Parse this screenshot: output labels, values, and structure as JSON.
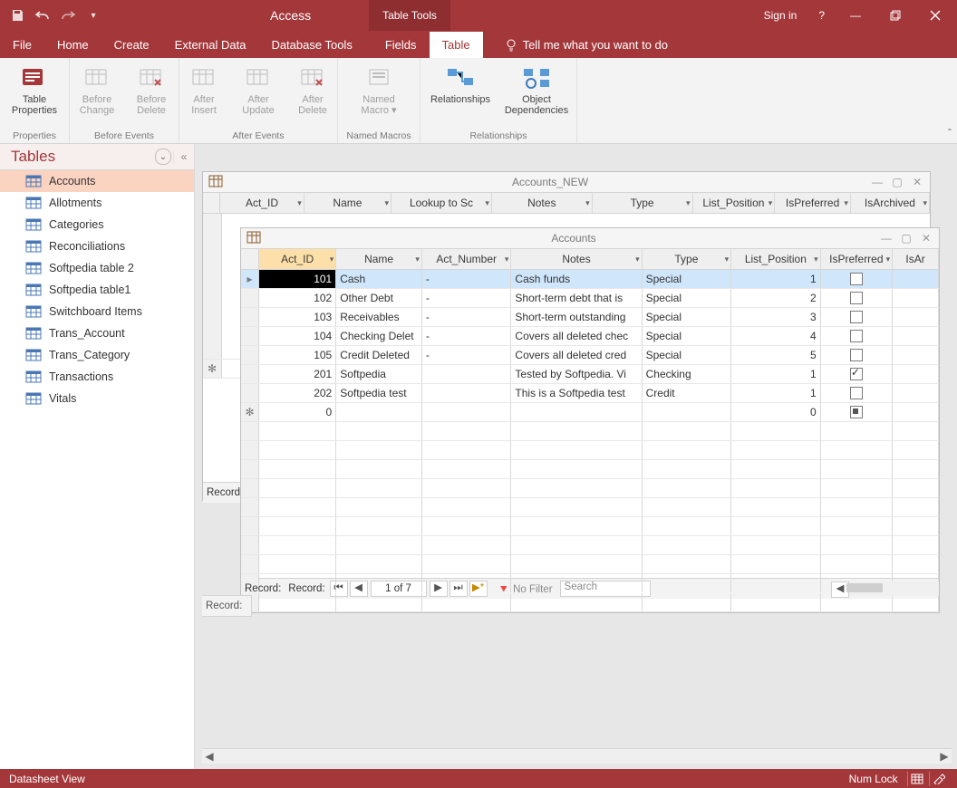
{
  "titlebar": {
    "app": "Access",
    "tool_context": "Table Tools",
    "signin": "Sign in"
  },
  "menutabs": {
    "file": "File",
    "home": "Home",
    "create": "Create",
    "external": "External Data",
    "dbtools": "Database Tools",
    "fields": "Fields",
    "table": "Table",
    "tellme": "Tell me what you want to do"
  },
  "ribbon": {
    "groups": {
      "properties": {
        "label": "Properties",
        "table_properties": "Table\nProperties"
      },
      "before": {
        "label": "Before Events",
        "before_change": "Before\nChange",
        "before_delete": "Before\nDelete"
      },
      "after": {
        "label": "After Events",
        "after_insert": "After\nInsert",
        "after_update": "After\nUpdate",
        "after_delete": "After\nDelete"
      },
      "macros": {
        "label": "Named Macros",
        "named_macro": "Named\nMacro ▾"
      },
      "relationships": {
        "label": "Relationships",
        "relationships": "Relationships",
        "object_deps": "Object\nDependencies"
      }
    }
  },
  "nav": {
    "title": "Tables",
    "items": [
      {
        "label": "Accounts",
        "selected": true
      },
      {
        "label": "Allotments"
      },
      {
        "label": "Categories"
      },
      {
        "label": "Reconciliations"
      },
      {
        "label": "Softpedia table 2"
      },
      {
        "label": "Softpedia table1"
      },
      {
        "label": "Switchboard Items"
      },
      {
        "label": "Trans_Account"
      },
      {
        "label": "Trans_Category"
      },
      {
        "label": "Transactions"
      },
      {
        "label": "Vitals"
      }
    ]
  },
  "back_window": {
    "title": "Accounts_NEW",
    "columns": [
      "Act_ID",
      "Name",
      "Lookup to Sc",
      "Notes",
      "Type",
      "List_Position",
      "IsPreferred",
      "IsArchived"
    ],
    "records_label": "Records"
  },
  "front_window": {
    "title": "Accounts",
    "columns": [
      "Act_ID",
      "Name",
      "Act_Number",
      "Notes",
      "Type",
      "List_Position",
      "IsPreferred",
      "IsAr"
    ],
    "rows": [
      {
        "Act_ID": "101",
        "Name": "Cash",
        "Act_Number": "-",
        "Notes": "Cash funds",
        "Type": "Special",
        "List_Position": "1",
        "IsPreferred": false,
        "selected": true
      },
      {
        "Act_ID": "102",
        "Name": "Other Debt",
        "Act_Number": "-",
        "Notes": "Short-term debt that is",
        "Type": "Special",
        "List_Position": "2",
        "IsPreferred": false
      },
      {
        "Act_ID": "103",
        "Name": "Receivables",
        "Act_Number": "-",
        "Notes": "Short-term outstanding",
        "Type": "Special",
        "List_Position": "3",
        "IsPreferred": false
      },
      {
        "Act_ID": "104",
        "Name": "Checking Delet",
        "Act_Number": "-",
        "Notes": "Covers all deleted chec",
        "Type": "Special",
        "List_Position": "4",
        "IsPreferred": false
      },
      {
        "Act_ID": "105",
        "Name": "Credit Deleted",
        "Act_Number": "-",
        "Notes": "Covers all deleted cred",
        "Type": "Special",
        "List_Position": "5",
        "IsPreferred": false
      },
      {
        "Act_ID": "201",
        "Name": "Softpedia",
        "Act_Number": "",
        "Notes": "Tested by Softpedia. Vi",
        "Type": "Checking",
        "List_Position": "1",
        "IsPreferred": true
      },
      {
        "Act_ID": "202",
        "Name": "Softpedia test",
        "Act_Number": "",
        "Notes": "This is a Softpedia test",
        "Type": "Credit",
        "List_Position": "1",
        "IsPreferred": false
      }
    ],
    "newrow": {
      "Act_ID": "0",
      "List_Position": "0"
    },
    "record_label1": "Record:",
    "record_label2": "Record:",
    "record_pos": "1 of 7",
    "filter_label": "No Filter",
    "search_placeholder": "Search"
  },
  "statusbar": {
    "view": "Datasheet View",
    "numlock": "Num Lock"
  }
}
